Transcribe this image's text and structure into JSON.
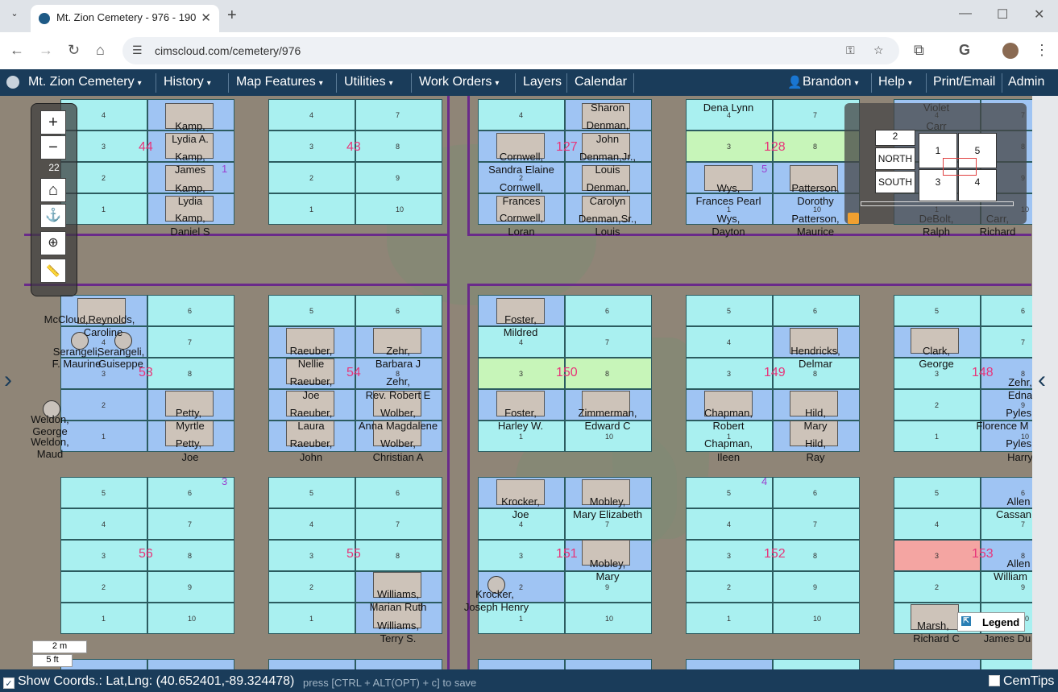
{
  "browser": {
    "tab_title": "Mt. Zion Cemetery - 976 - 190",
    "tab_close": "✕",
    "new_tab": "+",
    "url": "cimscloud.com/cemetery/976"
  },
  "nav": {
    "brand": "Mt. Zion Cemetery",
    "history": "History",
    "map_features": "Map Features",
    "utilities": "Utilities",
    "work_orders": "Work Orders",
    "layers": "Layers",
    "calendar": "Calendar",
    "user": "Brandon",
    "help": "Help",
    "print_email": "Print/Email",
    "admin": "Admin"
  },
  "map": {
    "zoom_in": "+",
    "zoom_out": "−",
    "zoom_level": "22",
    "overview": {
      "zone_2": "2",
      "north": "NORTH",
      "south": "SOUTH",
      "q1": "1",
      "q5": "5",
      "q3": "3",
      "q4": "4"
    },
    "scale_m": "2 m",
    "scale_ft": "5 ft",
    "legend": "Legend",
    "section_labels": [
      "1",
      "5",
      "3",
      "4"
    ],
    "blocks": [
      "44",
      "43",
      "127",
      "128",
      "53",
      "54",
      "150",
      "149",
      "148",
      "56",
      "55",
      "151",
      "152",
      "153"
    ],
    "names": [
      "Kamp,",
      "Lydia A.",
      "Kamp,",
      "James",
      "Kamp,",
      "Lydia",
      "Kamp,",
      "Daniel S",
      "Sharon",
      "Denman,",
      "John",
      "Denman,Jr.,",
      "Louis",
      "Denman,",
      "Carolyn",
      "Denman,Sr.,",
      "Louis",
      "Cornwell,",
      "Sandra Elaine",
      "Cornwell,",
      "Frances",
      "Cornwell,",
      "Loran",
      "Dena Lynn",
      "Wys,",
      "Frances Pearl",
      "Wys,",
      "Dayton",
      "Patterson,",
      "Dorothy",
      "Patterson,",
      "Maurice",
      "Violet",
      "Carr",
      "DeBolt,",
      "Ralph",
      "Carr,",
      "Richard",
      "McCloud,Reynolds,",
      "Caroline",
      "Serangeli,",
      "F. Maurine",
      "Serangeli,",
      "Guiseppe",
      "Weldon,",
      "George",
      "Weldon,",
      "Maud",
      "Petty,",
      "Myrtle",
      "Petty,",
      "Joe",
      "Raeuber,",
      "Nellie",
      "Raeuber,",
      "Joe",
      "Raeuber,",
      "Laura",
      "Raeuber,",
      "John",
      "Zehr,",
      "Barbara J",
      "Zehr,",
      "Rev. Robert E",
      "Wolber,",
      "Anna Magdalene",
      "Wolber,",
      "Christian A",
      "Foster,",
      "Mildred",
      "Foster,",
      "Harley W.",
      "Zimmerman,",
      "Edward C",
      "Hendricks,",
      "Delmar",
      "Chapman,",
      "Robert",
      "Chapman,",
      "Ileen",
      "Hild,",
      "Mary",
      "Hild,",
      "Ray",
      "Clark,",
      "George",
      "Zehr,",
      "Edna",
      "Pyles,",
      "Florence M",
      "Pyles,",
      "Harry",
      "Krocker,",
      "Joe",
      "Mobley,",
      "Mary Elizabeth",
      "Mobley,",
      "Mary",
      "Krocker,",
      "Joseph Henry",
      "Williams,",
      "Marian Ruth",
      "Williams,",
      "Terry S.",
      "Allen",
      "Cassan",
      "Allen",
      "William",
      "Marsh,",
      "Richard C",
      "James Du"
    ]
  },
  "status": {
    "show_coords": "Show Coords.: Lat,Lng: (40.652401,-89.324478)",
    "hint": "press [CTRL + ALT(OPT) + c] to save",
    "cemtips": "CemTips"
  }
}
